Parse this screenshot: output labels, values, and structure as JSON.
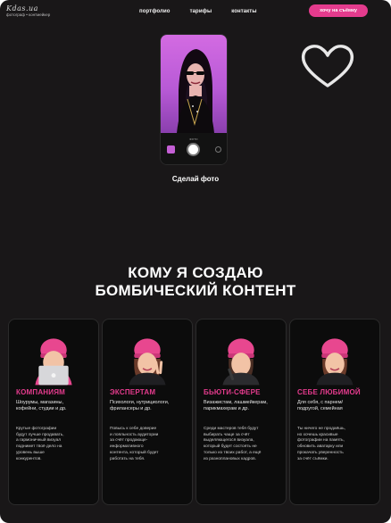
{
  "header": {
    "logo_script": "Kdas.ua",
    "logo_sub": "фотограф • контмейкер",
    "nav": [
      "портфолио",
      "тарифы",
      "контакты"
    ],
    "cta_label": "хочу на съёмку"
  },
  "hero": {
    "phone_mode_label": "ФОТО",
    "caption": "Сделай фото"
  },
  "headline": {
    "line1": "КОМУ Я СОЗДАЮ",
    "line2": "БОМБИЧЕСКИЙ КОНТЕНТ"
  },
  "cards": [
    {
      "title": "КОМПАНИЯМ",
      "short": "Шоурумы, магазины,\nкофейни, студии и др.",
      "long": "Крутые фотографии\nбудут лучше продавать,\nа гармоничный визуал\nподнимет твоё дело на\nуровень выше\nконкурентов."
    },
    {
      "title": "ЭКСПЕРТАМ",
      "short": "Психологи, нутрициологи,\nфрилансеры и др.",
      "long": "Повысь к себе доверие\nи лояльность аудитории\nза счёт продающе-\nинформативного\nконтента, который будет\nработать на тебя."
    },
    {
      "title": "БЬЮТИ-СФЕРЕ",
      "short": "Визажистам, лашмейкерам,\nпарикмахерам и др.",
      "long": "Среди мастеров тебя будут\nвыбирать чаще за счёт\nвыделяющегося визуала,\nкоторый будет состоять не\nтолько из твоих работ, а ещё\nиз разноплановых кадров."
    },
    {
      "title": "СЕБЕ ЛЮБИМОЙ",
      "short": "Для себя, с парнем/\nподругой, семейная",
      "long": "Ты ничего не продаёшь,\nно хочешь красивые\nфотографии на память,\nобновить аватарку или\nпрокачать уверенность\nза счёт съёмки."
    }
  ],
  "colors": {
    "accent": "#e43b8d",
    "background": "#191718",
    "card": "#0c0c0c"
  }
}
